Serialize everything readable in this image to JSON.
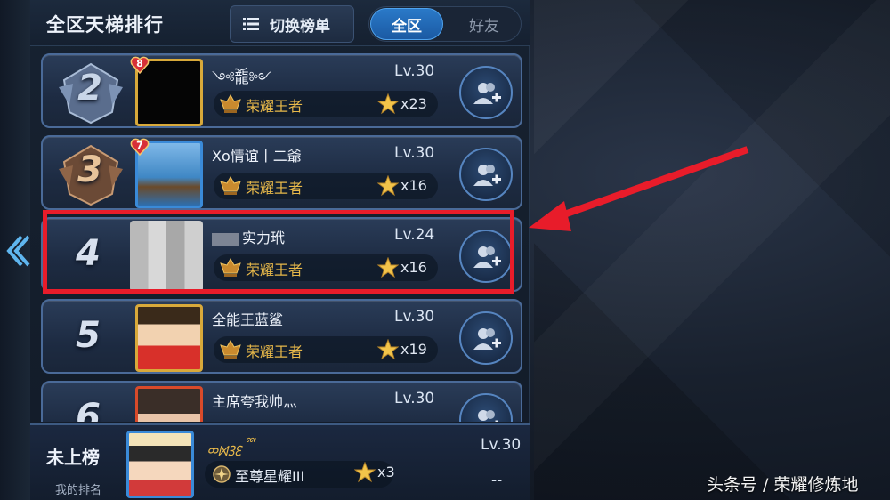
{
  "header": {
    "title": "全区天梯排行",
    "switch_label": "切换榜单",
    "seg_all": "全区",
    "seg_friends": "好友"
  },
  "rows": [
    {
      "rank": "2",
      "heart": "8",
      "name": "༺ོ龍༻",
      "level": "Lv.30",
      "tier": "荣耀王者",
      "stars": "x23"
    },
    {
      "rank": "3",
      "heart": "7",
      "name": "Xo情谊丨二爺",
      "level": "Lv.30",
      "tier": "荣耀王者",
      "stars": "x16"
    },
    {
      "rank": "4",
      "name": "实力玳",
      "level": "Lv.24",
      "tier": "荣耀王者",
      "stars": "x16"
    },
    {
      "rank": "5",
      "name": "全能王蓝鲨",
      "level": "Lv.30",
      "tier": "荣耀王者",
      "stars": "x19"
    },
    {
      "rank": "6",
      "name": "主席夸我帅灬",
      "level": "Lv.30",
      "tier": "",
      "stars": ""
    }
  ],
  "footer": {
    "label": "未上榜",
    "sublabel": "我的排名",
    "name": "ᢁᢂᢃᢄᢅ",
    "level": "Lv.30",
    "tier": "至尊星耀III",
    "stars": "x3",
    "rank_value": "--"
  },
  "watermark": "头条号 / 荣耀修炼地",
  "colors": {
    "highlight": "#e81c2a",
    "gold_tier": "#e7b84a",
    "accent_blue": "#2a79c8"
  }
}
